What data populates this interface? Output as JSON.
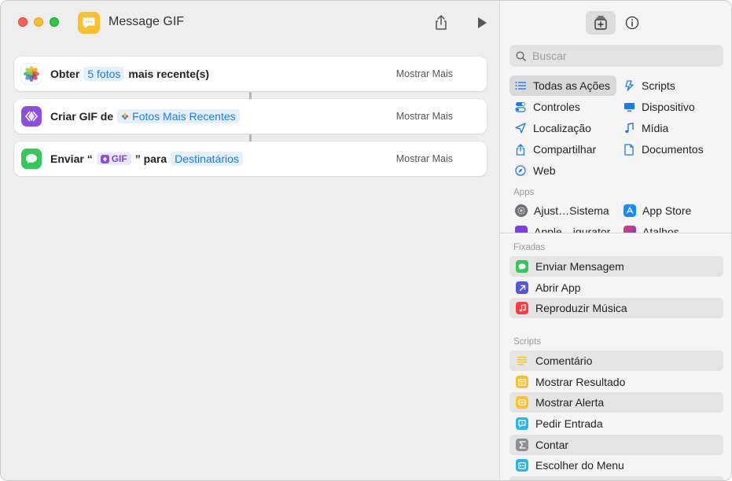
{
  "window": {
    "title": "Message GIF"
  },
  "actions": [
    {
      "verb": "Obter",
      "token": "5 fotos",
      "tail": "mais recente(s)",
      "more": "Mostrar Mais"
    },
    {
      "verb": "Criar GIF de",
      "token": "Fotos Mais Recentes",
      "more": "Mostrar Mais"
    },
    {
      "verb": "Enviar “",
      "token": "GIF",
      "mid": "” para",
      "token2": "Destinatários",
      "more": "Mostrar Mais"
    }
  ],
  "sidebar": {
    "search_placeholder": "Buscar",
    "categories": [
      {
        "label": "Todas as Ações",
        "icon": "list-icon",
        "selected": true
      },
      {
        "label": "Scripts",
        "icon": "scripts-icon"
      },
      {
        "label": "Controles",
        "icon": "toggles-icon"
      },
      {
        "label": "Dispositivo",
        "icon": "display-icon"
      },
      {
        "label": "Localização",
        "icon": "location-arrow-icon"
      },
      {
        "label": "Mídia",
        "icon": "music-note-icon"
      },
      {
        "label": "Compartilhar",
        "icon": "share-icon"
      },
      {
        "label": "Documentos",
        "icon": "document-icon"
      },
      {
        "label": "Web",
        "icon": "compass-icon"
      }
    ],
    "apps_label": "Apps",
    "apps": [
      {
        "label": "Ajust…Sistema",
        "icon": "settings-gear-icon"
      },
      {
        "label": "App Store",
        "icon": "app-store-icon"
      },
      {
        "label": "Apple…igurator",
        "icon": "configurator-icon"
      },
      {
        "label": "Atalhos",
        "icon": "shortcuts-icon"
      }
    ],
    "pinned_label": "Fixadas",
    "pinned": [
      {
        "label": "Enviar Mensagem",
        "icon": "messages-icon",
        "color": "#34c759"
      },
      {
        "label": "Abrir App",
        "icon": "open-app-arrow-icon",
        "color": "#5856d6"
      },
      {
        "label": "Reproduzir Música",
        "icon": "music-icon",
        "color": "#fc3c44"
      }
    ],
    "scripts_label": "Scripts",
    "scripts": [
      {
        "label": "Comentário",
        "icon": "comment-lines-icon",
        "color": "#f5c518"
      },
      {
        "label": "Mostrar Resultado",
        "icon": "show-result-icon",
        "color": "#fbc02d"
      },
      {
        "label": "Mostrar Alerta",
        "icon": "alert-icon",
        "color": "#fbc02d"
      },
      {
        "label": "Pedir Entrada",
        "icon": "ask-input-icon",
        "color": "#2fb4e9"
      },
      {
        "label": "Contar",
        "icon": "sigma-icon",
        "color": "#8e8e93"
      },
      {
        "label": "Escolher do Menu",
        "icon": "menu-icon",
        "color": "#2fb4e9"
      }
    ]
  }
}
